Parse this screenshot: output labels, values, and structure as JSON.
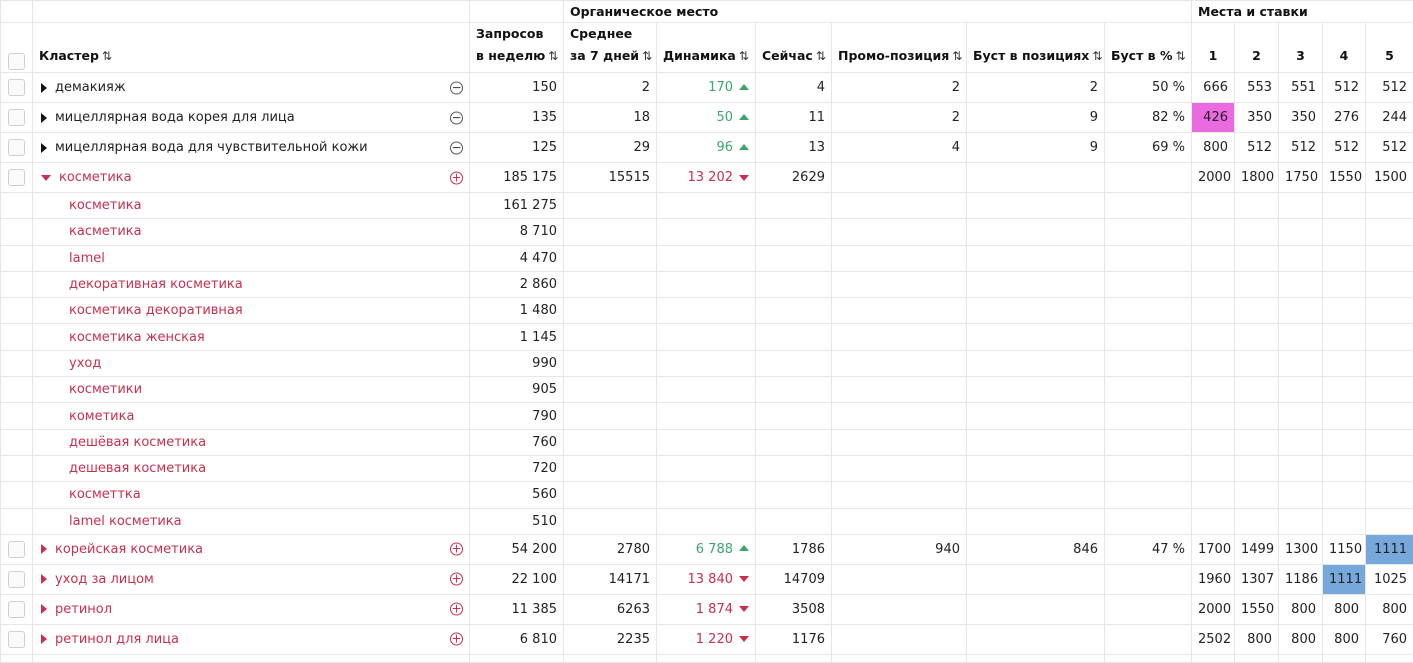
{
  "groups": {
    "organic": "Органическое место",
    "places": "Места и ставки"
  },
  "headers": {
    "cluster": "Кластер",
    "queries_l1": "Запросов",
    "queries_l2": "в неделю",
    "avg_l1": "Среднее",
    "avg_l2": "за 7 дней",
    "dynamics": "Динамика",
    "now": "Сейчас",
    "promo": "Промо-позиция",
    "boost_pos": "Буст в позициях",
    "boost_pct": "Буст в %",
    "p1": "1",
    "p2": "2",
    "p3": "3",
    "p4": "4",
    "p5": "5",
    "sort_icon": "sort-icon"
  },
  "rows": [
    {
      "label": "демакияж",
      "queries": "150",
      "avg": "2",
      "dyn": "170",
      "now": "4",
      "promo": "2",
      "boost_pos": "2",
      "boost_pct": "50 %",
      "p": [
        "666",
        "553",
        "551",
        "512",
        "512"
      ]
    },
    {
      "label": "мицеллярная вода корея для лица",
      "queries": "135",
      "avg": "18",
      "dyn": "50",
      "now": "11",
      "promo": "2",
      "boost_pos": "9",
      "boost_pct": "82 %",
      "p": [
        "426",
        "350",
        "350",
        "276",
        "244"
      ]
    },
    {
      "label": "мицеллярная вода для чувствительной кожи",
      "queries": "125",
      "avg": "29",
      "dyn": "96",
      "now": "13",
      "promo": "4",
      "boost_pos": "9",
      "boost_pct": "69 %",
      "p": [
        "800",
        "512",
        "512",
        "512",
        "512"
      ]
    },
    {
      "label": "косметика",
      "queries": "185 175",
      "avg": "15515",
      "dyn": "13 202",
      "now": "2629",
      "promo": "",
      "boost_pos": "",
      "boost_pct": "",
      "p": [
        "2000",
        "1800",
        "1750",
        "1550",
        "1500"
      ]
    },
    {
      "label": "корейская косметика",
      "queries": "54 200",
      "avg": "2780",
      "dyn": "6 788",
      "now": "1786",
      "promo": "940",
      "boost_pos": "846",
      "boost_pct": "47 %",
      "p": [
        "1700",
        "1499",
        "1300",
        "1150",
        "1111"
      ]
    },
    {
      "label": "уход за лицом",
      "queries": "22 100",
      "avg": "14171",
      "dyn": "13 840",
      "now": "14709",
      "promo": "",
      "boost_pos": "",
      "boost_pct": "",
      "p": [
        "1960",
        "1307",
        "1186",
        "1111",
        "1025"
      ]
    },
    {
      "label": "ретинол",
      "queries": "11 385",
      "avg": "6263",
      "dyn": "1 874",
      "now": "3508",
      "promo": "",
      "boost_pos": "",
      "boost_pct": "",
      "p": [
        "2000",
        "1550",
        "800",
        "800",
        "800"
      ]
    },
    {
      "label": "ретинол для лица",
      "queries": "6 810",
      "avg": "2235",
      "dyn": "1 220",
      "now": "1176",
      "promo": "",
      "boost_pos": "",
      "boost_pct": "",
      "p": [
        "2502",
        "800",
        "800",
        "800",
        "760"
      ]
    }
  ],
  "subrows": [
    {
      "label": "косметика",
      "queries": "161 275"
    },
    {
      "label": "касметика",
      "queries": "8 710"
    },
    {
      "label": "lamel",
      "queries": "4 470"
    },
    {
      "label": "декоративная косметика",
      "queries": "2 860"
    },
    {
      "label": "косметика декоративная",
      "queries": "1 480"
    },
    {
      "label": "косметика женская",
      "queries": "1 145"
    },
    {
      "label": "уход",
      "queries": "990"
    },
    {
      "label": "косметики",
      "queries": "905"
    },
    {
      "label": "кометика",
      "queries": "790"
    },
    {
      "label": "дешёвая косметика",
      "queries": "760"
    },
    {
      "label": "дешевая косметика",
      "queries": "720"
    },
    {
      "label": "косметтка",
      "queries": "560"
    },
    {
      "label": "lamel косметика",
      "queries": "510"
    }
  ],
  "colors": {
    "up": "#3aa56f",
    "down": "#c8304f",
    "highlight_pink": "#ec6ae0",
    "highlight_blue": "#77a8dc"
  }
}
